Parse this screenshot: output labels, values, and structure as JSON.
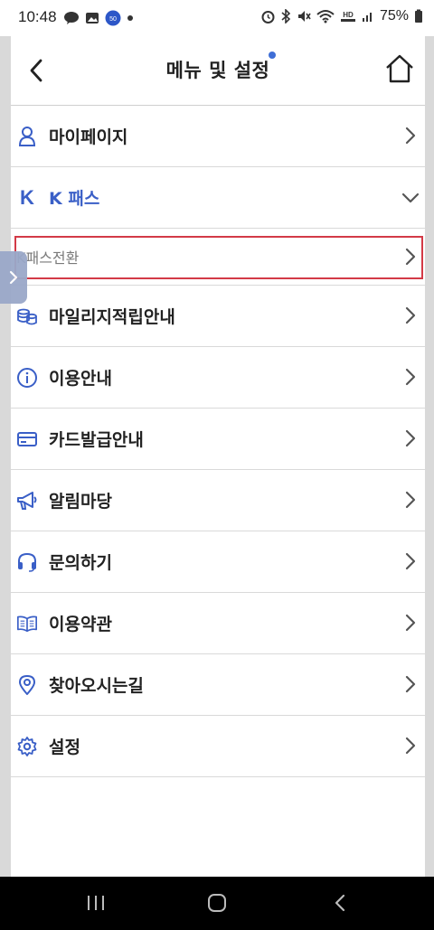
{
  "status_bar": {
    "time": "10:48",
    "battery": "75%",
    "left_icons": [
      "talk-icon",
      "gallery-icon",
      "app-icon",
      "dot-icon"
    ],
    "right_icons": [
      "alarm-icon",
      "bluetooth-icon",
      "mute-icon",
      "wifi-icon",
      "hd-voice-icon",
      "signal-icon",
      "battery-icon"
    ]
  },
  "header": {
    "title": "메뉴 및 설정",
    "has_notification_dot": true,
    "accent_color": "#3f6ed6"
  },
  "menu": {
    "items": [
      {
        "label": "마이페이지",
        "icon": "person-icon"
      },
      {
        "label": "K 패스",
        "icon": "k-logo-icon",
        "expanded": true,
        "k": "K"
      },
      {
        "label": "K패스전환",
        "icon": "",
        "sub": true,
        "highlighted": true
      },
      {
        "label": "마일리지적립안내",
        "icon": "coins-icon"
      },
      {
        "label": "이용안내",
        "icon": "info-icon"
      },
      {
        "label": "카드발급안내",
        "icon": "card-icon"
      },
      {
        "label": "알림마당",
        "icon": "megaphone-icon"
      },
      {
        "label": "문의하기",
        "icon": "headset-icon"
      },
      {
        "label": "이용약관",
        "icon": "book-icon"
      },
      {
        "label": "찾아오시는길",
        "icon": "location-pin-icon"
      },
      {
        "label": "설정",
        "icon": "gear-icon"
      }
    ]
  },
  "colors": {
    "highlight_border": "#d33a47",
    "icon_blue": "#3a5fc7"
  },
  "nav_bar": {
    "buttons": [
      "recent-apps-icon",
      "home-circle-icon",
      "back-icon"
    ]
  }
}
